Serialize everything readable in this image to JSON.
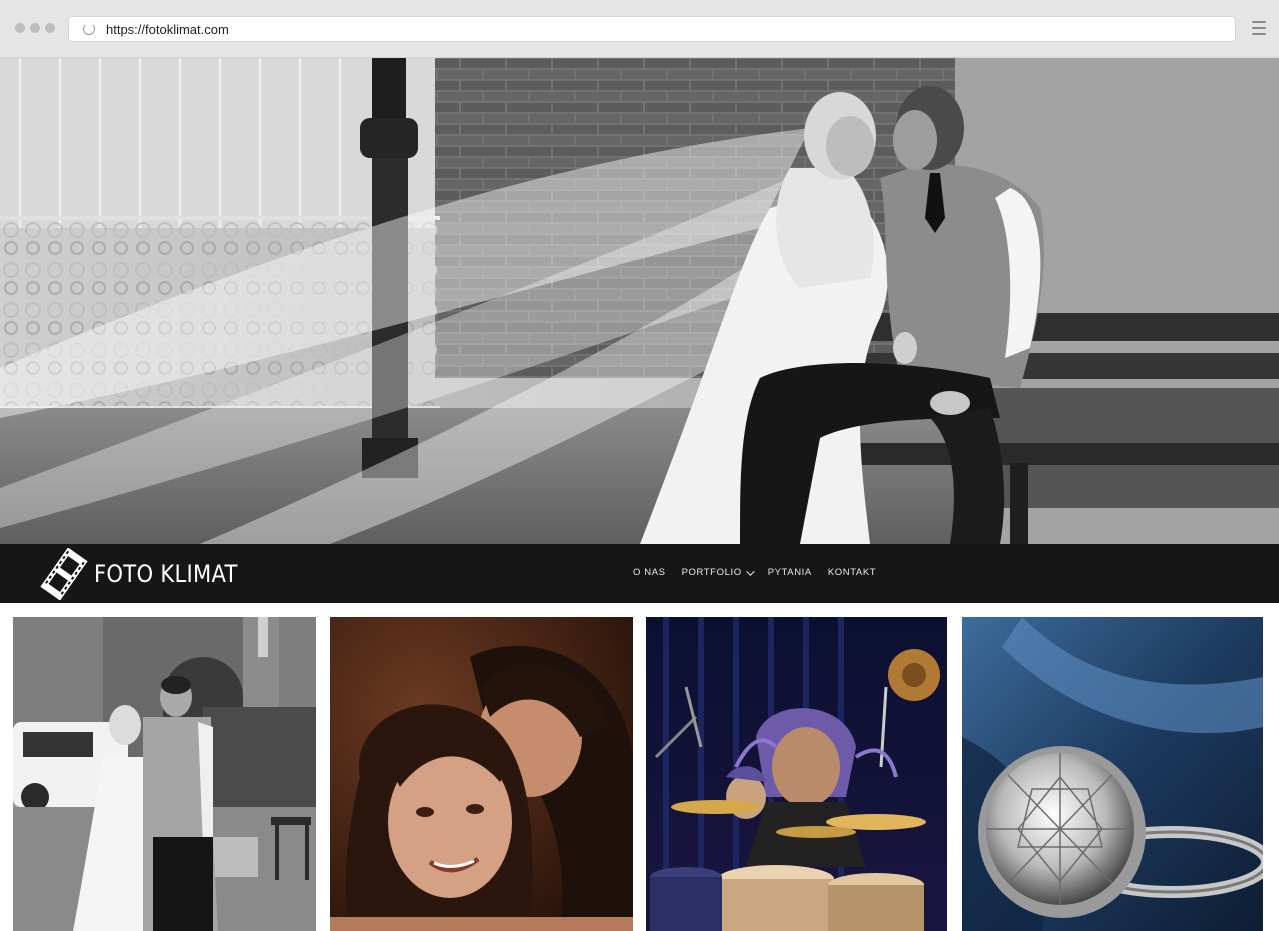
{
  "browser": {
    "url": "https://fotoklimat.com"
  },
  "icons": {
    "reload": "reload-icon",
    "menu": "hamburger-menu-icon",
    "logo": "film-strip-logo-icon",
    "dropdown": "chevron-down-icon"
  },
  "site": {
    "logo_text": "FOTO KLIMAT"
  },
  "nav": {
    "items": [
      {
        "label": "O NAS"
      },
      {
        "label": "PORTFOLIO"
      },
      {
        "label": "PYTANIA"
      },
      {
        "label": "KONTAKT"
      }
    ]
  },
  "colors": {
    "navbar_bg": "#161616",
    "nav_text": "#eaeaea",
    "chrome_bg": "#e5e5e5"
  }
}
